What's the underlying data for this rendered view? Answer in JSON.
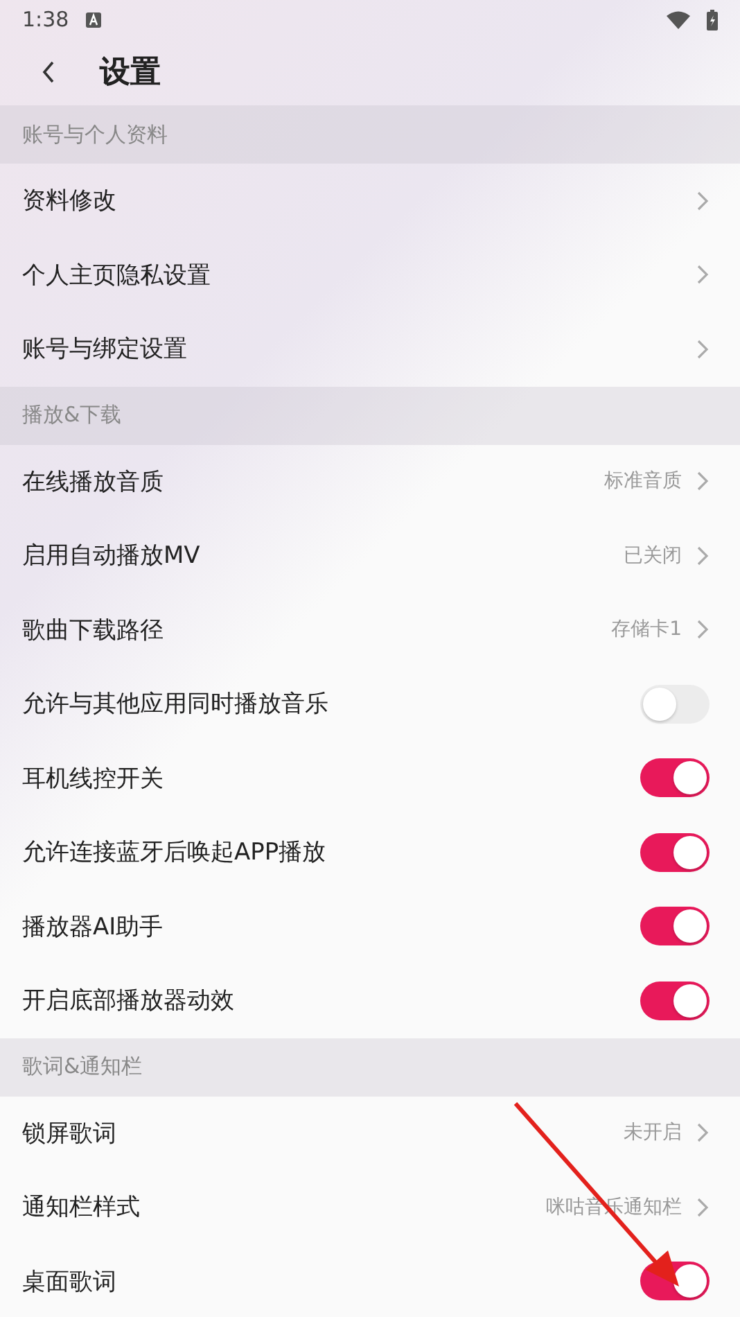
{
  "status_bar": {
    "time": "1:38"
  },
  "header": {
    "title": "设置"
  },
  "sections": [
    {
      "title": "账号与个人资料",
      "items": [
        {
          "kind": "link",
          "label": "资料修改"
        },
        {
          "kind": "link",
          "label": "个人主页隐私设置"
        },
        {
          "kind": "link",
          "label": "账号与绑定设置"
        }
      ]
    },
    {
      "title": "播放&下载",
      "items": [
        {
          "kind": "link",
          "label": "在线播放音质",
          "value": "标准音质"
        },
        {
          "kind": "link",
          "label": "启用自动播放MV",
          "value": "已关闭"
        },
        {
          "kind": "link",
          "label": "歌曲下载路径",
          "value": "存储卡1"
        },
        {
          "kind": "toggle",
          "label": "允许与其他应用同时播放音乐",
          "on": false
        },
        {
          "kind": "toggle",
          "label": "耳机线控开关",
          "on": true
        },
        {
          "kind": "toggle",
          "label": "允许连接蓝牙后唤起APP播放",
          "on": true
        },
        {
          "kind": "toggle",
          "label": "播放器AI助手",
          "on": true
        },
        {
          "kind": "toggle",
          "label": "开启底部播放器动效",
          "on": true
        }
      ]
    },
    {
      "title": "歌词&通知栏",
      "items": [
        {
          "kind": "link",
          "label": "锁屏歌词",
          "value": "未开启"
        },
        {
          "kind": "link",
          "label": "通知栏样式",
          "value": "咪咕音乐通知栏"
        },
        {
          "kind": "toggle",
          "label": "桌面歌词",
          "on": true
        }
      ]
    }
  ]
}
